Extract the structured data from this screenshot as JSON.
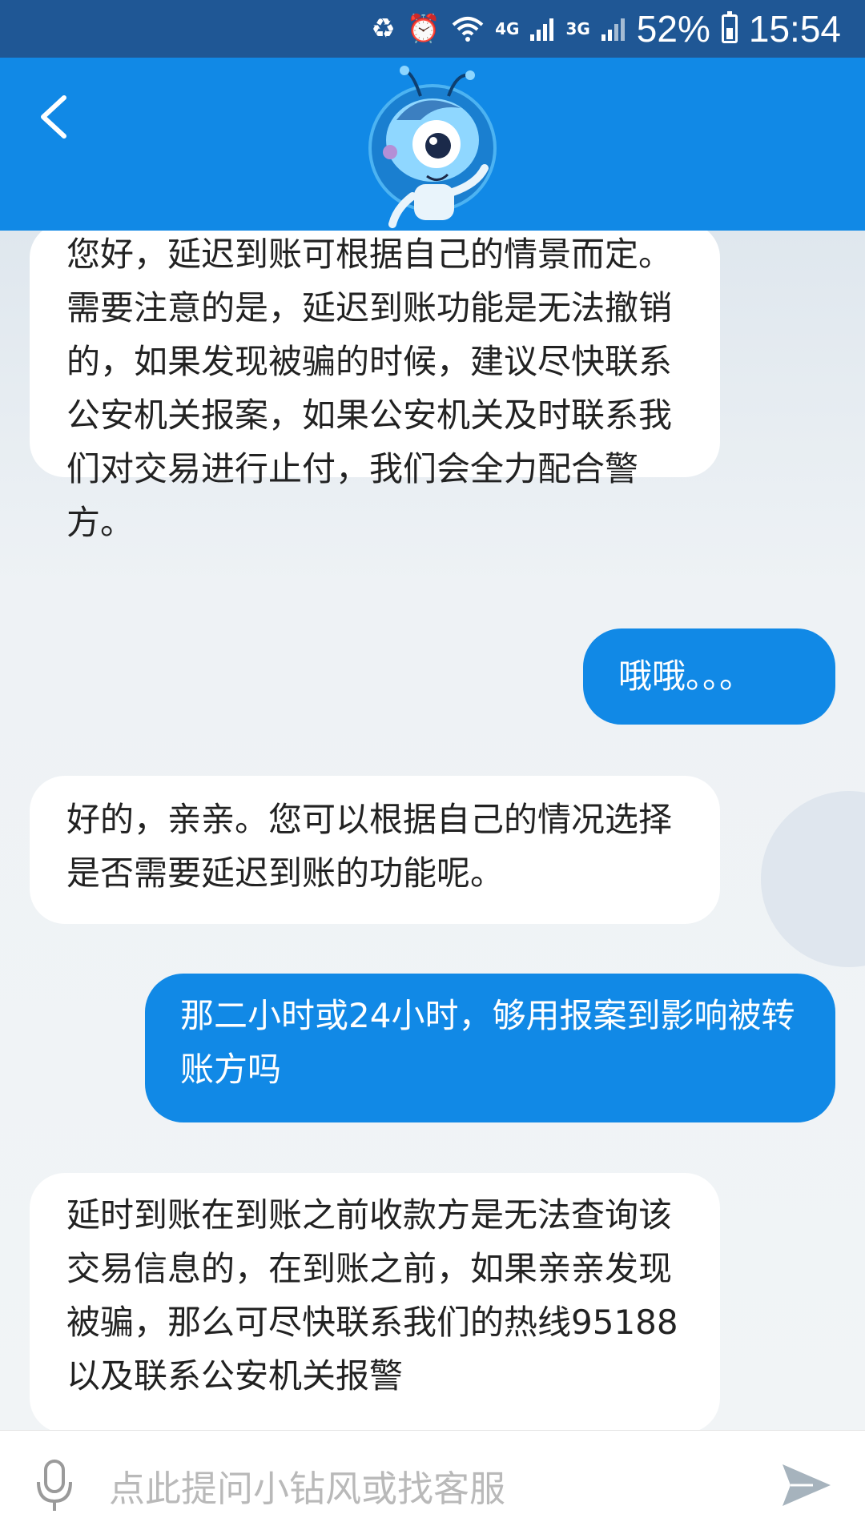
{
  "status_bar": {
    "network_4g": "4G",
    "network_3g": "3G",
    "battery_pct": "52%",
    "time": "15:54"
  },
  "header": {
    "back_icon": "chevron-left-icon",
    "avatar_icon": "ant-mascot-icon"
  },
  "messages": [
    {
      "sender": "bot",
      "text": "您好，延迟到账可根据自己的情景而定。需要注意的是，延迟到账功能是无法撤销的，如果发现被骗的时候，建议尽快联系公安机关报案，如果公安机关及时联系我们对交易进行止付，我们会全力配合警方。"
    },
    {
      "sender": "user",
      "text": "哦哦。。。"
    },
    {
      "sender": "bot",
      "text": "好的，亲亲。您可以根据自己的情况选择是否需要延迟到账的功能呢。"
    },
    {
      "sender": "user",
      "text": "那二小时或24小时，够用报案到影响被转账方吗"
    },
    {
      "sender": "bot",
      "text": "延时到账在到账之前收款方是无法查询该交易信息的，在到账之前，如果亲亲发现被骗，那么可尽快联系我们的热线95188以及联系公安机关报警"
    }
  ],
  "input": {
    "placeholder": "点此提问小钻风或找客服"
  },
  "colors": {
    "status_bar": "#1f5795",
    "header": "#1189e6",
    "user_bubble": "#1189e6",
    "bot_bubble": "#ffffff"
  }
}
